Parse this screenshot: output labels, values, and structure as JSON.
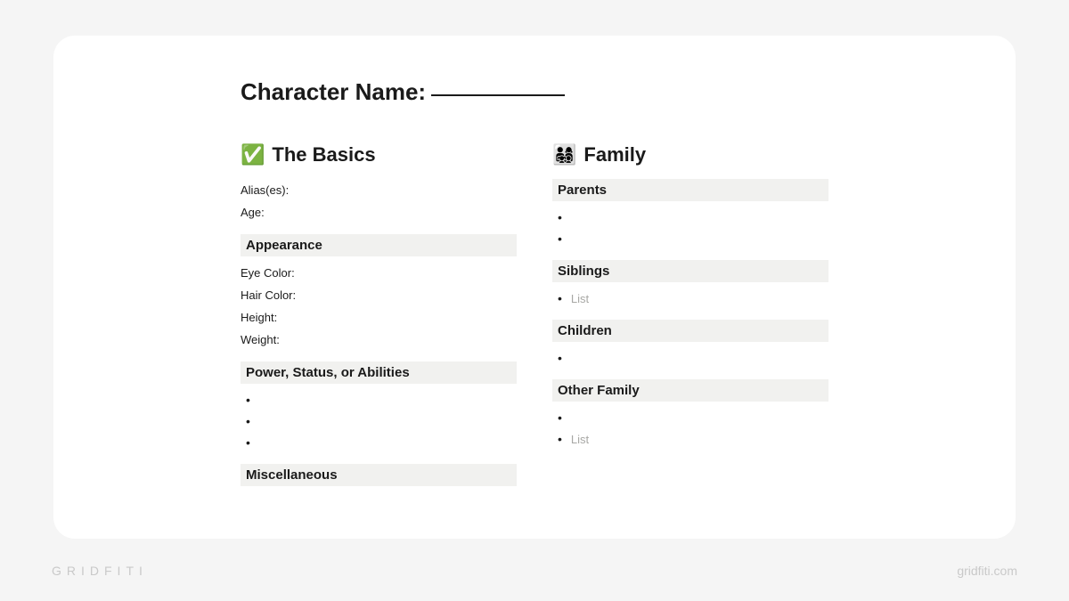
{
  "title_label": "Character Name:",
  "left": {
    "icon": "✅",
    "heading": "The Basics",
    "fields_top": [
      "Alias(es):",
      "Age:"
    ],
    "sections": [
      {
        "heading": "Appearance",
        "fields": [
          "Eye Color:",
          "Hair Color:",
          "Height:",
          "Weight:"
        ]
      },
      {
        "heading": "Power, Status, or Abilities",
        "bullets": [
          "",
          "",
          ""
        ]
      },
      {
        "heading": "Miscellaneous"
      }
    ]
  },
  "right": {
    "icon": "👨‍👩‍👧‍👦",
    "heading": "Family",
    "sections": [
      {
        "heading": "Parents",
        "bullets": [
          "",
          ""
        ]
      },
      {
        "heading": "Siblings",
        "bullets_placeholder": [
          "List"
        ]
      },
      {
        "heading": "Children",
        "bullets": [
          ""
        ]
      },
      {
        "heading": "Other Family",
        "bullets_mixed": [
          {
            "text": "",
            "placeholder": false
          },
          {
            "text": "List",
            "placeholder": true
          }
        ]
      }
    ]
  },
  "watermark_left": "GRIDFITI",
  "watermark_right": "gridfiti.com"
}
